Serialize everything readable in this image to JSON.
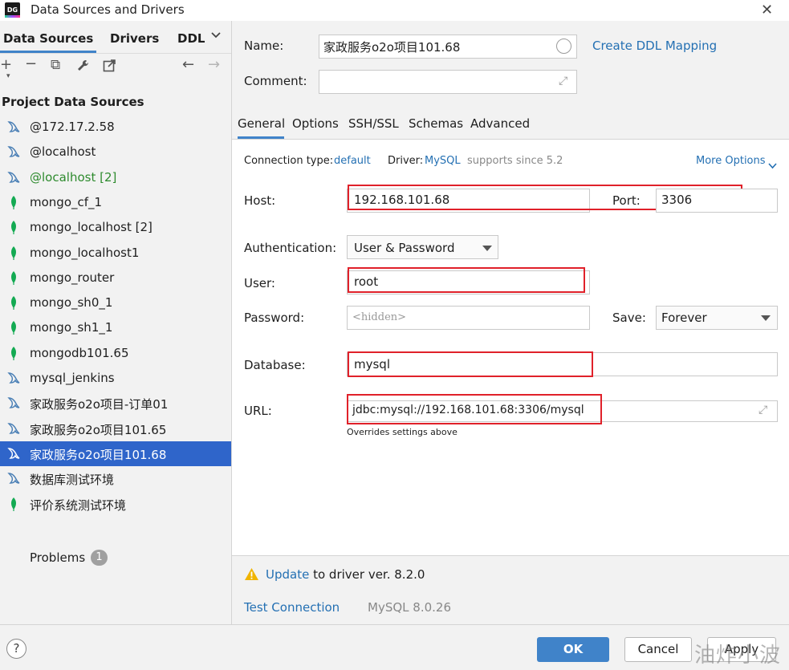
{
  "window": {
    "title": "Data Sources and Drivers",
    "logo": "DG",
    "close": "✕"
  },
  "left_tabs": {
    "data_sources": "Data Sources",
    "drivers": "Drivers",
    "ddl": "DDL"
  },
  "toolbar": {
    "add": "+",
    "remove": "−",
    "copy": "⧉",
    "wrench": "🔧",
    "open": "↗",
    "back": "←",
    "forward": "→"
  },
  "project_heading": "Project Data Sources",
  "data_sources": [
    {
      "label": "@172.17.2.58",
      "icon": "mysql-dolphin-icon"
    },
    {
      "label": "@localhost",
      "icon": "mysql-dolphin-icon"
    },
    {
      "label": "@localhost [2]",
      "icon": "mysql-dolphin-icon"
    },
    {
      "label": "mongo_cf_1",
      "icon": "mongodb-leaf-icon"
    },
    {
      "label": "mongo_localhost [2]",
      "icon": "mongodb-leaf-icon"
    },
    {
      "label": "mongo_localhost1",
      "icon": "mongodb-leaf-icon"
    },
    {
      "label": "mongo_router",
      "icon": "mongodb-leaf-icon"
    },
    {
      "label": "mongo_sh0_1",
      "icon": "mongodb-leaf-icon"
    },
    {
      "label": "mongo_sh1_1",
      "icon": "mongodb-leaf-icon"
    },
    {
      "label": "mongodb101.65",
      "icon": "mongodb-leaf-icon"
    },
    {
      "label": "mysql_jenkins",
      "icon": "mysql-dolphin-icon"
    },
    {
      "label": "家政服务o2o项目-订单01",
      "icon": "mysql-dolphin-icon"
    },
    {
      "label": "家政服务o2o项目101.65",
      "icon": "mysql-dolphin-icon"
    },
    {
      "label": "家政服务o2o项目101.68",
      "icon": "mysql-dolphin-icon"
    },
    {
      "label": "数据库测试环境",
      "icon": "mysql-dolphin-icon"
    },
    {
      "label": "评价系统测试环境",
      "icon": "mongodb-leaf-icon"
    }
  ],
  "problems": {
    "label": "Problems",
    "count": "1"
  },
  "form": {
    "name_label": "Name:",
    "name_value": "家政服务o2o项目101.68",
    "create_ddl": "Create DDL Mapping",
    "comment_label": "Comment:",
    "comment_value": ""
  },
  "tabs": [
    "General",
    "Options",
    "SSH/SSL",
    "Schemas",
    "Advanced"
  ],
  "general": {
    "conn_type_label": "Connection type:",
    "conn_type_value": "default",
    "driver_label": "Driver:",
    "driver_value": "MySQL",
    "driver_note": "supports since 5.2",
    "more_options": "More Options",
    "host_label": "Host:",
    "host_value": "192.168.101.68",
    "port_label": "Port:",
    "port_value": "3306",
    "auth_label": "Authentication:",
    "auth_value": "User & Password",
    "user_label": "User:",
    "user_value": "root",
    "password_label": "Password:",
    "password_placeholder": "<hidden>",
    "save_label": "Save:",
    "save_value": "Forever",
    "database_label": "Database:",
    "database_value": "mysql",
    "url_label": "URL:",
    "url_value": "jdbc:mysql://192.168.101.68:3306/mysql",
    "url_note": "Overrides settings above"
  },
  "bottom": {
    "update_link": "Update",
    "update_text": " to driver ver. 8.2.0",
    "test_connection": "Test Connection",
    "mysql_version": "MySQL 8.0.26"
  },
  "footer": {
    "help": "?",
    "ok": "OK",
    "cancel": "Cancel",
    "apply": "Apply"
  },
  "watermark": "油炸小波",
  "colors": {
    "accent": "#4083c9",
    "selection": "#2f65ca",
    "highlight_box": "#e0212a",
    "link": "#2470b3",
    "green_label": "#2e8b2e",
    "mongo_leaf": "#13aa52"
  }
}
